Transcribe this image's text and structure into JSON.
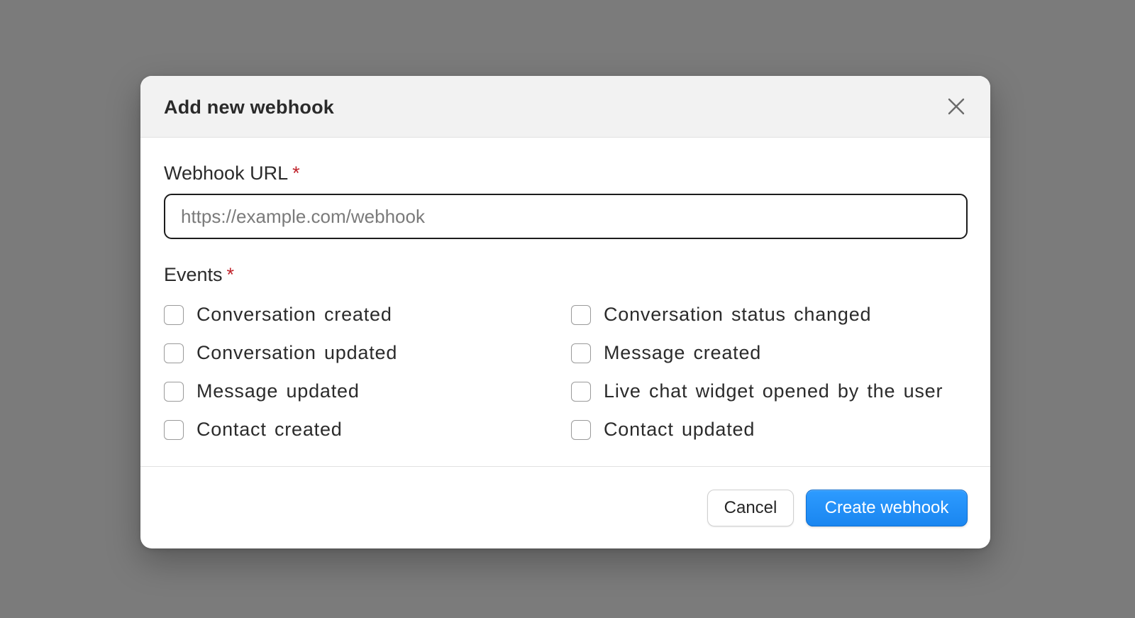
{
  "modal": {
    "title": "Add new webhook",
    "close_icon": "close-icon"
  },
  "url_field": {
    "label": "Webhook URL",
    "required_mark": "*",
    "placeholder": "https://example.com/webhook",
    "value": ""
  },
  "events": {
    "label": "Events",
    "required_mark": "*",
    "items": [
      {
        "label": "Conversation created",
        "checked": false
      },
      {
        "label": "Conversation status changed",
        "checked": false
      },
      {
        "label": "Conversation updated",
        "checked": false
      },
      {
        "label": "Message created",
        "checked": false
      },
      {
        "label": "Message updated",
        "checked": false
      },
      {
        "label": "Live chat widget opened by the user",
        "checked": false
      },
      {
        "label": "Contact created",
        "checked": false
      },
      {
        "label": "Contact updated",
        "checked": false
      }
    ]
  },
  "footer": {
    "cancel_label": "Cancel",
    "create_label": "Create webhook"
  },
  "colors": {
    "backdrop": "#7b7b7b",
    "primary": "#1a86f0",
    "required": "#c0232b"
  }
}
